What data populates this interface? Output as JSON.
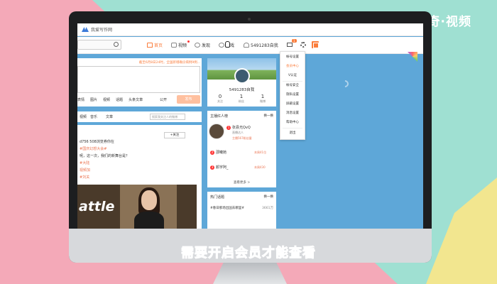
{
  "watermark": "天奇·视频",
  "window": {
    "title": "我爱写作网"
  },
  "nav": {
    "home": "首页",
    "video": "视频",
    "discover": "发现",
    "games": "游戏",
    "user": "5491283自我",
    "message_badge": "1"
  },
  "composer": {
    "notice": "截至6月8日24时，全国新增确诊病例9例...",
    "tools": [
      "表情",
      "图片",
      "视频",
      "话题",
      "头条文章"
    ],
    "visibility": "公开",
    "post_label": "发布"
  },
  "feed_tabs": {
    "tabs": [
      "视频",
      "音乐",
      "文章"
    ],
    "group_search_placeholder": "搜索我关注人的微博"
  },
  "feed_card": {
    "follow_label": "+关注",
    "lines": [
      "d756 508浏览券你在",
      "#国庆幻想大会#",
      "呢，这一次，我们的新舞台是？",
      "#大陆",
      "视频加",
      "#刘关"
    ],
    "video_text": "attle"
  },
  "profile": {
    "username": "5491283自我",
    "stats": [
      {
        "value": "0",
        "label": "关注"
      },
      {
        "value": "1",
        "label": "粉丝"
      },
      {
        "value": "1",
        "label": "微博"
      }
    ]
  },
  "hot_people": {
    "title": "主播红人榜",
    "refresh": "换一换",
    "entries": [
      {
        "rank": "1",
        "name": "张县光QvQ",
        "sub": "直播达人",
        "tag": "主播567粉丝量"
      },
      {
        "rank": "2",
        "name": "邵曦她",
        "sub": "",
        "tag": "本周41位"
      },
      {
        "rank": "3",
        "name": "颜宇阿_",
        "sub": "",
        "tag": "本周430"
      }
    ],
    "more": "查看更多 >"
  },
  "hot_topics": {
    "title": "热门话题",
    "refresh": "换一换",
    "topic": "#春日那场出国去哪里#",
    "count": "3661万"
  },
  "dropdown": {
    "items": [
      "帐号设置",
      "会员中心",
      "V认证",
      "帐号安全",
      "隐私设置",
      "屏蔽设置",
      "消息设置",
      "帮助中心",
      "退出"
    ],
    "active_index": 1
  },
  "caption": "需要开启会员才能查看",
  "colors": {
    "accent": "#fa7d3c",
    "caption": "#2fa6ff"
  }
}
